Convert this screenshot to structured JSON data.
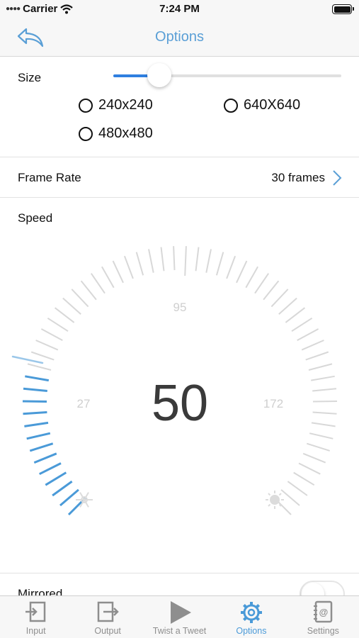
{
  "status_bar": {
    "carrier": "Carrier",
    "time": "7:24 PM"
  },
  "nav": {
    "title": "Options",
    "back_icon": "reply-back-arrow-icon"
  },
  "size": {
    "label": "Size",
    "slider_value_fraction": 0.2,
    "options": [
      "240x240",
      "640X640",
      "480x480"
    ]
  },
  "frame_rate": {
    "label": "Frame Rate",
    "value": "30 frames"
  },
  "speed": {
    "label": "Speed",
    "value": "50",
    "tick_labels": [
      "95",
      "27",
      "172"
    ],
    "level_fraction": 0.22,
    "colors": {
      "active": "#4a9ad8",
      "inactive": "#d8d8d8"
    },
    "icons": [
      "snowflake-icon",
      "sun-icon"
    ]
  },
  "mirrored": {
    "label": "Mirrored",
    "on": false
  },
  "tabs": [
    {
      "label": "Input",
      "icon": "input-icon"
    },
    {
      "label": "Output",
      "icon": "output-icon"
    },
    {
      "label": "Twist a Tweet",
      "icon": "play-icon"
    },
    {
      "label": "Options",
      "icon": "gear-icon",
      "active": true
    },
    {
      "label": "Settings",
      "icon": "address-book-icon"
    }
  ],
  "accent_color": "#5a9fd6"
}
